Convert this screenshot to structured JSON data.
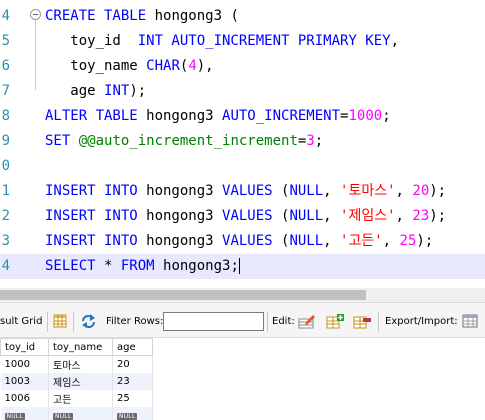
{
  "editor": {
    "lines": [
      {
        "n": "4",
        "parts": [
          {
            "t": "CREATE TABLE",
            "c": "kw"
          },
          {
            "t": " hongong3 ("
          }
        ]
      },
      {
        "n": "5",
        "parts": [
          {
            "t": "   toy_id  "
          },
          {
            "t": "INT AUTO_INCREMENT PRIMARY KEY",
            "c": "kw"
          },
          {
            "t": ","
          }
        ]
      },
      {
        "n": "6",
        "parts": [
          {
            "t": "   toy_name "
          },
          {
            "t": "CHAR",
            "c": "kw"
          },
          {
            "t": "("
          },
          {
            "t": "4",
            "c": "num"
          },
          {
            "t": "),"
          }
        ]
      },
      {
        "n": "7",
        "parts": [
          {
            "t": "   age "
          },
          {
            "t": "INT",
            "c": "kw"
          },
          {
            "t": ");"
          }
        ]
      },
      {
        "n": "8",
        "parts": [
          {
            "t": "ALTER TABLE",
            "c": "kw"
          },
          {
            "t": " hongong3 "
          },
          {
            "t": "AUTO_INCREMENT",
            "c": "kw"
          },
          {
            "t": "="
          },
          {
            "t": "1000",
            "c": "num"
          },
          {
            "t": ";"
          }
        ]
      },
      {
        "n": "9",
        "parts": [
          {
            "t": "SET",
            "c": "kw"
          },
          {
            "t": " "
          },
          {
            "t": "@@auto_increment_increment",
            "c": "sv"
          },
          {
            "t": "="
          },
          {
            "t": "3",
            "c": "num"
          },
          {
            "t": ";"
          }
        ]
      },
      {
        "n": "0",
        "parts": []
      },
      {
        "n": "1",
        "parts": [
          {
            "t": "INSERT INTO",
            "c": "kw"
          },
          {
            "t": " hongong3 "
          },
          {
            "t": "VALUES",
            "c": "kw"
          },
          {
            "t": " ("
          },
          {
            "t": "NULL",
            "c": "kw"
          },
          {
            "t": ", "
          },
          {
            "t": "'토마스'",
            "c": "str"
          },
          {
            "t": ", "
          },
          {
            "t": "20",
            "c": "num"
          },
          {
            "t": ");"
          }
        ]
      },
      {
        "n": "2",
        "parts": [
          {
            "t": "INSERT INTO",
            "c": "kw"
          },
          {
            "t": " hongong3 "
          },
          {
            "t": "VALUES",
            "c": "kw"
          },
          {
            "t": " ("
          },
          {
            "t": "NULL",
            "c": "kw"
          },
          {
            "t": ", "
          },
          {
            "t": "'제임스'",
            "c": "str"
          },
          {
            "t": ", "
          },
          {
            "t": "23",
            "c": "num"
          },
          {
            "t": ");"
          }
        ]
      },
      {
        "n": "3",
        "parts": [
          {
            "t": "INSERT INTO",
            "c": "kw"
          },
          {
            "t": " hongong3 "
          },
          {
            "t": "VALUES",
            "c": "kw"
          },
          {
            "t": " ("
          },
          {
            "t": "NULL",
            "c": "kw"
          },
          {
            "t": ", "
          },
          {
            "t": "'고든'",
            "c": "str"
          },
          {
            "t": ", "
          },
          {
            "t": "25",
            "c": "num"
          },
          {
            "t": ");"
          }
        ]
      },
      {
        "n": "4",
        "parts": [
          {
            "t": "SELECT",
            "c": "kw"
          },
          {
            "t": " * "
          },
          {
            "t": "FROM",
            "c": "kw"
          },
          {
            "t": " hongong3;"
          }
        ],
        "current": true
      }
    ]
  },
  "toolbar": {
    "grid_label": "sult Grid",
    "filter_label": "Filter Rows:",
    "filter_value": "",
    "edit_label": "Edit:",
    "export_label": "Export/Import:"
  },
  "grid": {
    "columns": [
      "toy_id",
      "toy_name",
      "age"
    ],
    "rows": [
      [
        "1000",
        "토마스",
        "20"
      ],
      [
        "1003",
        "제임스",
        "23"
      ],
      [
        "1006",
        "고든",
        "25"
      ]
    ],
    "null_label": "NULL"
  },
  "colors": {
    "keyword": "#0000ff",
    "number": "#ff00ff",
    "string": "#ff0000",
    "system_variable": "#008000",
    "line_number": "#2b91af",
    "current_line": "#e8e8ff"
  }
}
